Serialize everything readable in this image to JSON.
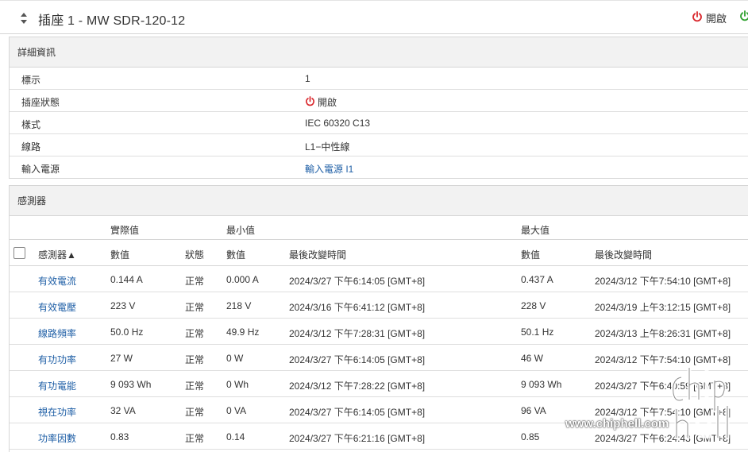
{
  "header": {
    "title": "插座 1 - MW SDR-120-12",
    "state_label": "開啟",
    "colors": {
      "power_off": "#d9262b",
      "power_on": "#2ea12e",
      "link": "#1f5fa6"
    }
  },
  "details": {
    "heading": "詳細資訊",
    "rows": [
      {
        "label": "標示",
        "value": "1"
      },
      {
        "label": "插座狀態",
        "value": "開啟",
        "icon": "power-icon"
      },
      {
        "label": "樣式",
        "value": "IEC 60320 C13"
      },
      {
        "label": "線路",
        "value": "L1−中性線"
      },
      {
        "label": "輸入電源",
        "value": "輸入電源 I1",
        "link": true
      }
    ]
  },
  "sensors": {
    "heading": "感測器",
    "groups": {
      "actual": "實際值",
      "min": "最小值",
      "max": "最大值"
    },
    "columns": {
      "sensor": "感測器▲",
      "value": "數值",
      "state": "狀態",
      "min_value": "數值",
      "min_time": "最後改變時間",
      "max_value": "數值",
      "max_time": "最後改變時間"
    },
    "rows": [
      {
        "name": "有效電流",
        "value": "0.144 A",
        "state": "正常",
        "min": "0.000 A",
        "min_time": "2024/3/27 下午6:14:05 [GMT+8]",
        "max": "0.437 A",
        "max_time": "2024/3/12 下午7:54:10 [GMT+8]"
      },
      {
        "name": "有效電壓",
        "value": "223 V",
        "state": "正常",
        "min": "218 V",
        "min_time": "2024/3/16 下午6:41:12 [GMT+8]",
        "max": "228 V",
        "max_time": "2024/3/19 上午3:12:15 [GMT+8]"
      },
      {
        "name": "線路頻率",
        "value": "50.0 Hz",
        "state": "正常",
        "min": "49.9 Hz",
        "min_time": "2024/3/12 下午7:28:31 [GMT+8]",
        "max": "50.1 Hz",
        "max_time": "2024/3/13 上午8:26:31 [GMT+8]"
      },
      {
        "name": "有功功率",
        "value": "27 W",
        "state": "正常",
        "min": "0 W",
        "min_time": "2024/3/27 下午6:14:05 [GMT+8]",
        "max": "46 W",
        "max_time": "2024/3/12 下午7:54:10 [GMT+8]"
      },
      {
        "name": "有功電能",
        "value": "9 093 Wh",
        "state": "正常",
        "min": "0 Wh",
        "min_time": "2024/3/12 下午7:28:22 [GMT+8]",
        "max": "9 093 Wh",
        "max_time": "2024/3/27 下午6:40:59 [GMT+8]"
      },
      {
        "name": "視在功率",
        "value": "32 VA",
        "state": "正常",
        "min": "0 VA",
        "min_time": "2024/3/27 下午6:14:05 [GMT+8]",
        "max": "96 VA",
        "max_time": "2024/3/12 下午7:54:10 [GMT+8]"
      },
      {
        "name": "功率因數",
        "value": "0.83",
        "state": "正常",
        "min": "0.14",
        "min_time": "2024/3/27 下午6:21:16 [GMT+8]",
        "max": "0.85",
        "max_time": "2024/3/27 下午6:24:43 [GMT+8]"
      }
    ]
  },
  "watermark": {
    "text": "www.chiphell.com"
  }
}
